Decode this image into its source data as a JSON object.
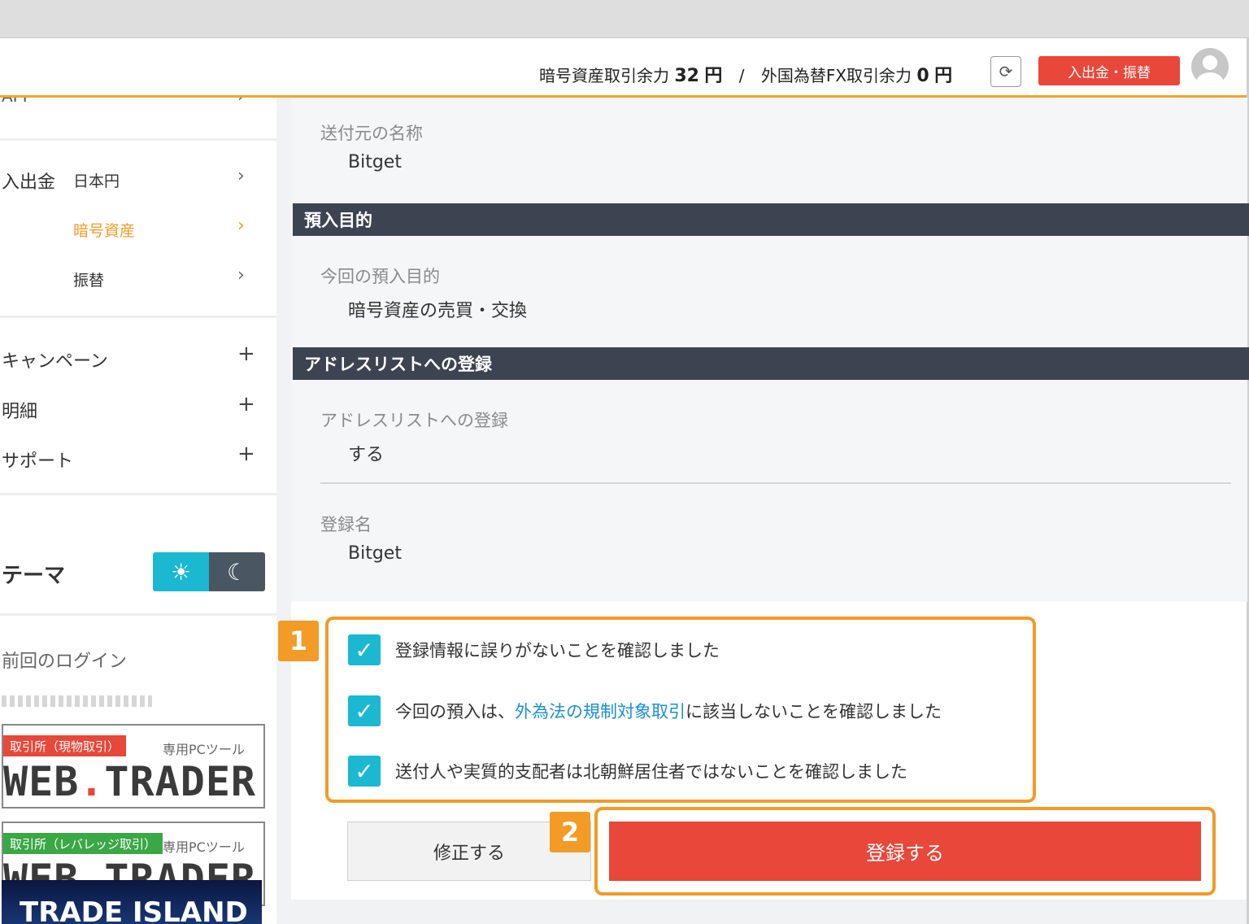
{
  "header": {
    "crypto_label": "暗号資産取引余力",
    "crypto_amount": "32",
    "crypto_unit": "円",
    "separator": "/",
    "fx_label": "外国為替FX取引余力",
    "fx_amount": "0",
    "fx_unit": "円",
    "refresh_icon": "⟳",
    "deposit_button": "入出金・振替"
  },
  "sidebar": {
    "api_partial": "API",
    "deposit_section": "入出金",
    "items": [
      {
        "label": "日本円"
      },
      {
        "label": "暗号資産"
      },
      {
        "label": "振替"
      }
    ],
    "menus": [
      {
        "label": "キャンペーン"
      },
      {
        "label": "明細"
      },
      {
        "label": "サポート"
      }
    ],
    "theme_label": "テーマ",
    "theme_light_icon": "☀",
    "theme_dark_icon": "☾",
    "last_login_label": "前回のログイン",
    "banners": [
      {
        "tag": "取引所（現物取引）",
        "pc": "専用PCツール",
        "logo_a": "WEB",
        "logo_b": ".",
        "logo_c": "TRADER"
      },
      {
        "tag": "取引所（レバレッジ取引）",
        "pc": "専用PCツール",
        "logo_a": "WEB",
        "logo_b": ".",
        "logo_c": "TRADER"
      }
    ],
    "trade_island": "TRADE ISLAND"
  },
  "content": {
    "sender_name_label": "送付元の名称",
    "sender_name_value": "Bitget",
    "purpose_section": "預入目的",
    "purpose_label": "今回の預入目的",
    "purpose_value": "暗号資産の売買・交換",
    "address_section": "アドレスリストへの登録",
    "address_label": "アドレスリストへの登録",
    "address_value": "する",
    "reg_name_label": "登録名",
    "reg_name_value": "Bitget"
  },
  "checks": {
    "c1": "登録情報に誤りがないことを確認しました",
    "c2_pre": "今回の預入は、",
    "c2_link": "外為法の規制対象取引",
    "c2_post": "に該当しないことを確認しました",
    "c3": "送付人や実質的支配者は北朝鮮居住者ではないことを確認しました",
    "check_icon": "✓"
  },
  "buttons": {
    "fix": "修正する",
    "register": "登録する"
  },
  "annotations": {
    "badge1": "1",
    "badge2": "2"
  },
  "colors": {
    "accent_orange": "#f5a623",
    "brand_red": "#e8473a",
    "checkbox_cyan": "#1ab8d1",
    "section_dark": "#3b4450"
  }
}
